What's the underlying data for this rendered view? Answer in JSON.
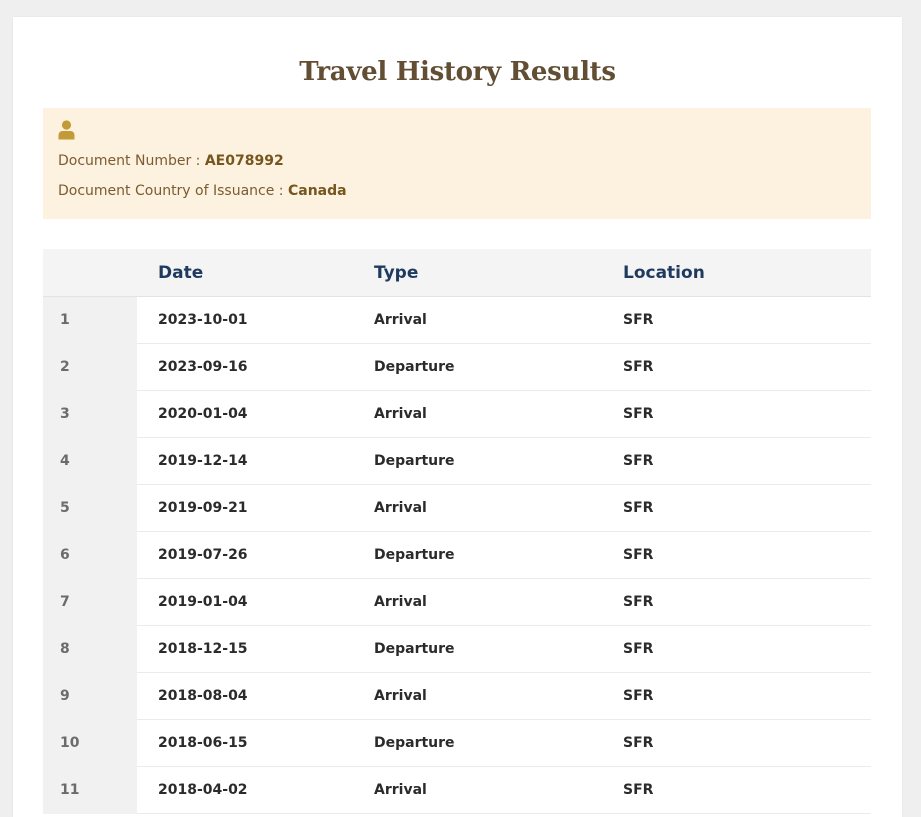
{
  "page": {
    "title": "Travel History Results"
  },
  "document": {
    "icon": "user-icon",
    "number_label": "Document Number : ",
    "number_value": "AE078992",
    "country_label": "Document Country of Issuance : ",
    "country_value": "Canada"
  },
  "table": {
    "headers": {
      "index": "",
      "date": "Date",
      "type": "Type",
      "location": "Location"
    },
    "rows": [
      {
        "index": "1",
        "date": "2023-10-01",
        "type": "Arrival",
        "location": "SFR"
      },
      {
        "index": "2",
        "date": "2023-09-16",
        "type": "Departure",
        "location": "SFR"
      },
      {
        "index": "3",
        "date": "2020-01-04",
        "type": "Arrival",
        "location": "SFR"
      },
      {
        "index": "4",
        "date": "2019-12-14",
        "type": "Departure",
        "location": "SFR"
      },
      {
        "index": "5",
        "date": "2019-09-21",
        "type": "Arrival",
        "location": "SFR"
      },
      {
        "index": "6",
        "date": "2019-07-26",
        "type": "Departure",
        "location": "SFR"
      },
      {
        "index": "7",
        "date": "2019-01-04",
        "type": "Arrival",
        "location": "SFR"
      },
      {
        "index": "8",
        "date": "2018-12-15",
        "type": "Departure",
        "location": "SFR"
      },
      {
        "index": "9",
        "date": "2018-08-04",
        "type": "Arrival",
        "location": "SFR"
      },
      {
        "index": "10",
        "date": "2018-06-15",
        "type": "Departure",
        "location": "SFR"
      },
      {
        "index": "11",
        "date": "2018-04-02",
        "type": "Arrival",
        "location": "SFR"
      }
    ]
  },
  "colors": {
    "title": "#614e33",
    "doc_background": "#fdf2e0",
    "doc_icon": "#c39a38",
    "header_text": "#1f3a5f"
  }
}
